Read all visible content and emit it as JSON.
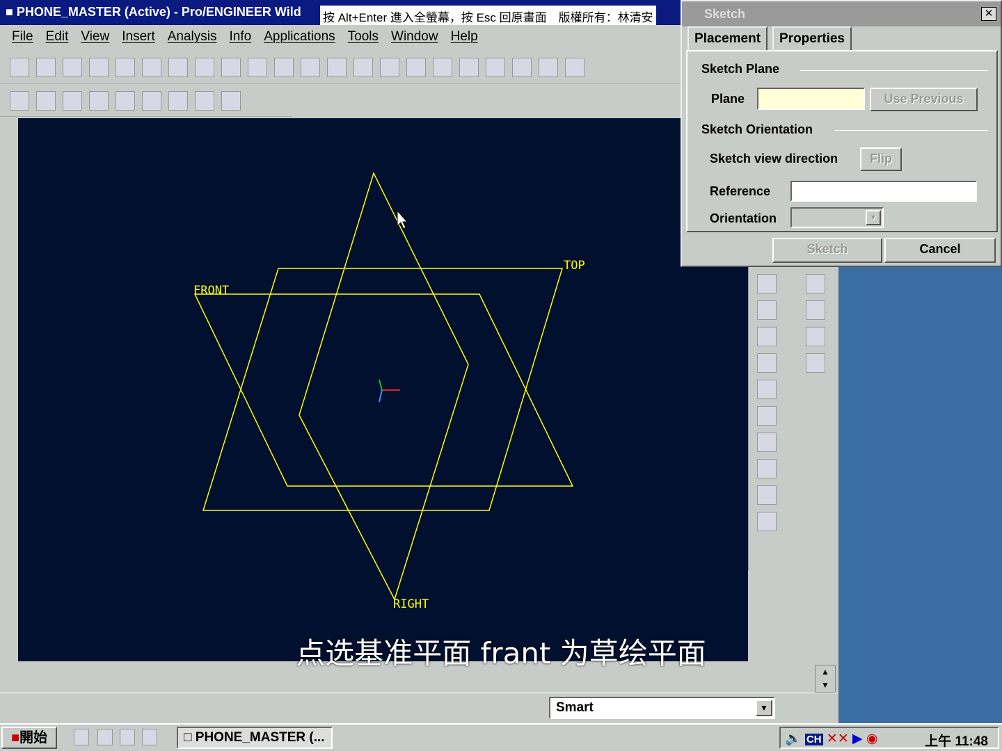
{
  "window": {
    "title": "PHONE_MASTER (Active) - Pro/ENGINEER Wild",
    "osd": "按 Alt+Enter 進入全螢幕，按 Esc 回原畫面　版權所有：林清安"
  },
  "menu": [
    "File",
    "Edit",
    "View",
    "Insert",
    "Analysis",
    "Info",
    "Applications",
    "Tools",
    "Window",
    "Help"
  ],
  "canvas": {
    "planes": [
      "TOP",
      "FRONT",
      "RIGHT"
    ],
    "line_color": "#ffff00",
    "background": "#00102e"
  },
  "subtitle": "点选基准平面 frant 为草绘平面",
  "dialog": {
    "title": "Sketch",
    "tabs": [
      "Placement",
      "Properties"
    ],
    "sketch_plane": "Sketch Plane",
    "plane_label": "Plane",
    "plane_value": "",
    "use_previous": "Use Previous",
    "sketch_orientation": "Sketch Orientation",
    "view_direction": "Sketch view direction",
    "flip": "Flip",
    "reference": "Reference",
    "reference_value": "",
    "orientation": "Orientation",
    "orientation_value": "",
    "sketch_btn": "Sketch",
    "cancel_btn": "Cancel"
  },
  "status": {
    "filter": "Smart"
  },
  "taskbar": {
    "start": "開始",
    "task": "PHONE_MASTER (...",
    "clock": "上午 11:48",
    "ime": "CH"
  }
}
